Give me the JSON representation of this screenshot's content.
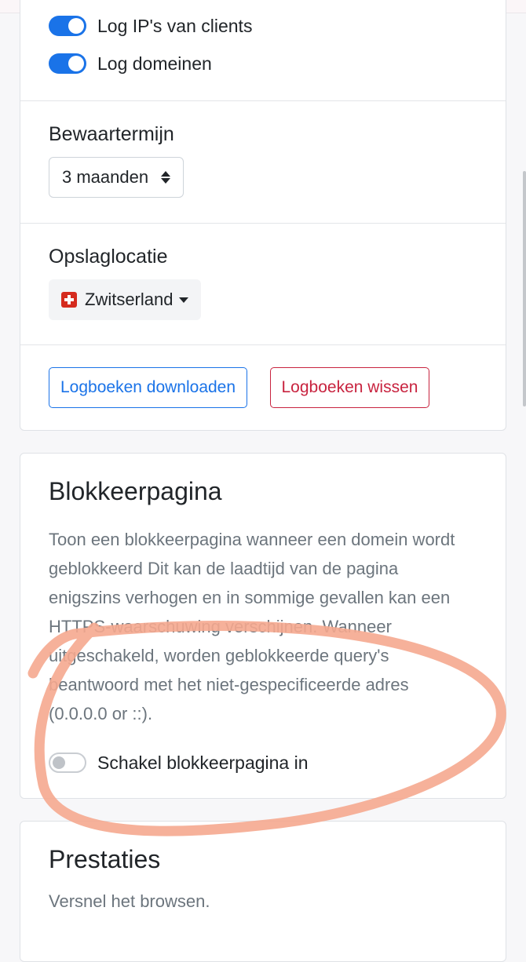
{
  "logging": {
    "toggles": [
      {
        "label": "Log IP's van clients",
        "on": true
      },
      {
        "label": "Log domeinen",
        "on": true
      }
    ],
    "retention": {
      "title": "Bewaartermijn",
      "value": "3 maanden"
    },
    "storage": {
      "title": "Opslaglocatie",
      "value": "Zwitserland",
      "flag": "swiss-flag-icon"
    },
    "buttons": {
      "download": "Logboeken downloaden",
      "clear": "Logboeken wissen"
    }
  },
  "blockpage": {
    "title": "Blokkeerpagina",
    "description": "Toon een blokkeerpagina wanneer een domein wordt geblokkeerd Dit kan de laadtijd van de pagina enigszins verhogen en in sommige gevallen kan een HTTPS-waarschuwing verschijnen. Wanneer uitgeschakeld, worden geblokkeerde query's beantwoord met het niet-gespecificeerde adres (0.0.0.0 or ::).",
    "toggle": {
      "label": "Schakel blokkeerpagina in",
      "on": false
    }
  },
  "performance": {
    "title": "Prestaties",
    "description": "Versnel het browsen."
  },
  "colors": {
    "accent": "#1a73e8",
    "danger": "#c8233f",
    "annotation": "#f5a98f"
  }
}
